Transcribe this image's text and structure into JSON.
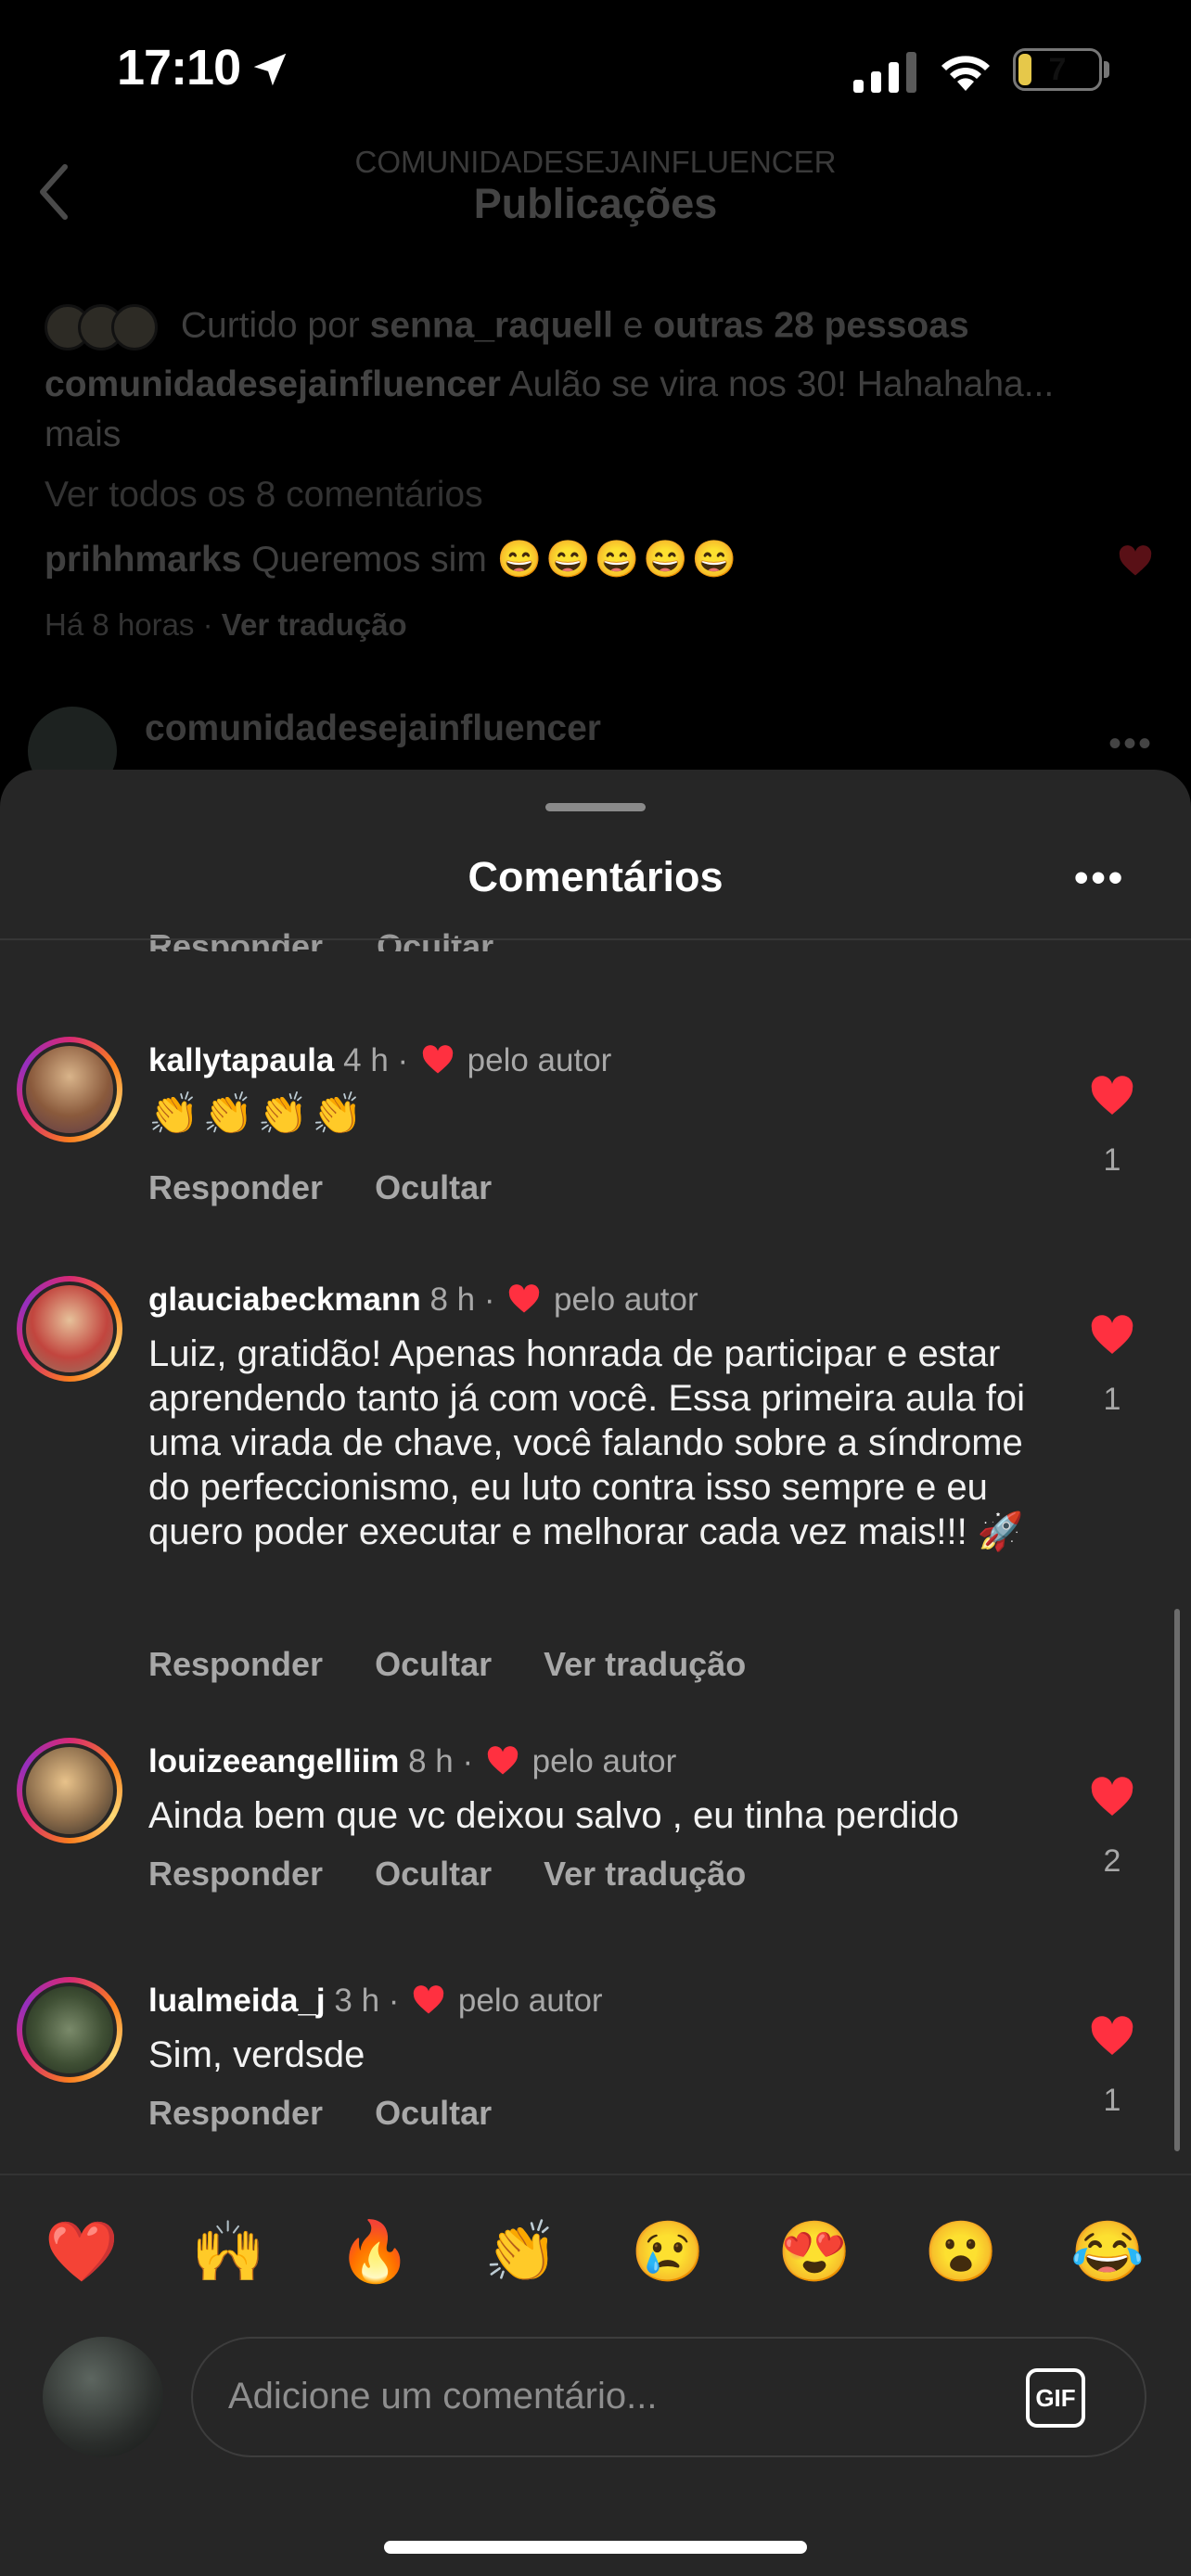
{
  "status_bar": {
    "time": "17:10",
    "battery": "7"
  },
  "background_post": {
    "header_subtitle": "COMUNIDADESEJAINFLUENCER",
    "header_title": "Publicações",
    "liked_prefix": "Curtido por",
    "liked_user": "senna_raquell",
    "liked_and": "e",
    "liked_others": "outras 28 pessoas",
    "caption_user": "comunidadesejainfluencer",
    "caption_text": "Aulão se vira nos 30! Hahahaha...",
    "caption_more": "mais",
    "view_all": "Ver todos os 8 comentários",
    "top_comment_user": "prihhmarks",
    "top_comment_text": "Queremos sim",
    "top_comment_emojis": "😄😄😄😄😄",
    "meta_time": "Há 8 horas",
    "meta_sep": "·",
    "meta_translate": "Ver tradução",
    "next_post_user": "comunidadesejainfluencer"
  },
  "sheet": {
    "title": "Comentários",
    "clipped_actions": [
      "Responder",
      "Ocultar"
    ],
    "comments": [
      {
        "user": "kallytapaula",
        "time": "4 h",
        "by_author": "pelo autor",
        "text": "👏👏👏👏",
        "actions": [
          "Responder",
          "Ocultar"
        ],
        "likes": "1"
      },
      {
        "user": "glauciabeckmann",
        "time": "8 h",
        "by_author": "pelo autor",
        "text": "Luiz, gratidão! Apenas honrada de participar e estar aprendendo tanto já com você. Essa primeira aula foi uma virada de chave, você falando sobre a síndrome do perfeccionismo, eu luto contra isso sempre e eu quero poder executar e melhorar cada vez mais!!! 🚀",
        "actions": [
          "Responder",
          "Ocultar",
          "Ver tradução"
        ],
        "likes": "1"
      },
      {
        "user": "louizeeangelliim",
        "time": "8 h",
        "by_author": "pelo autor",
        "text": "Ainda bem que vc deixou salvo , eu tinha perdido",
        "actions": [
          "Responder",
          "Ocultar",
          "Ver tradução"
        ],
        "likes": "2"
      },
      {
        "user": "lualmeida_j",
        "time": "3 h",
        "by_author": "pelo autor",
        "text": "Sim, verdsde",
        "actions": [
          "Responder",
          "Ocultar"
        ],
        "likes": "1"
      }
    ]
  },
  "reactions": [
    "❤️",
    "🙌",
    "🔥",
    "👏",
    "😢",
    "😍",
    "😮",
    "😂"
  ],
  "composer": {
    "placeholder": "Adicione um comentário...",
    "gif_label": "GIF"
  },
  "colors": {
    "sheet_bg": "#262626",
    "like_red": "#ff3040",
    "muted_text": "#a8a8a8"
  }
}
